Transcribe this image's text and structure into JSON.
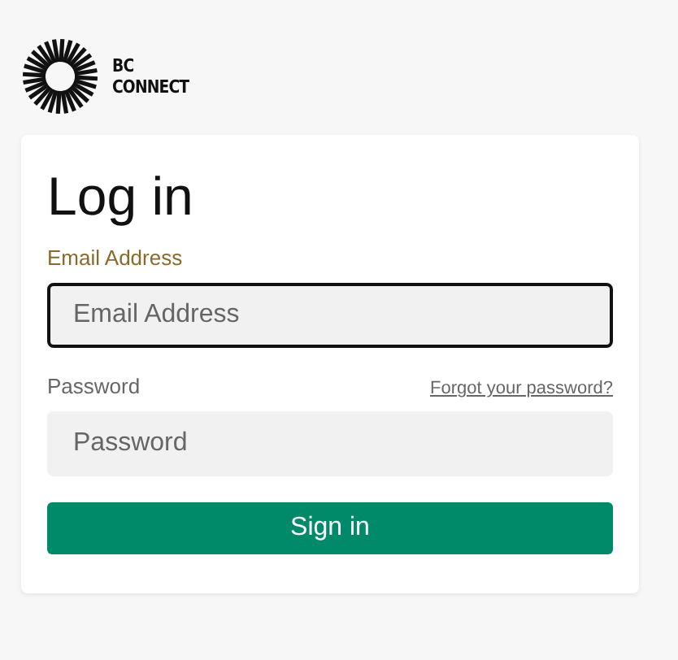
{
  "logo": {
    "lines": [
      "BC",
      "CONNECT"
    ]
  },
  "form": {
    "title": "Log in",
    "fields": [
      {
        "label": "Email Address",
        "placeholder": "Email Address",
        "focused": true
      },
      {
        "label": "Password",
        "placeholder": "Password",
        "focused": false,
        "link": "Forgot your password?"
      }
    ],
    "submit": "Sign in"
  }
}
